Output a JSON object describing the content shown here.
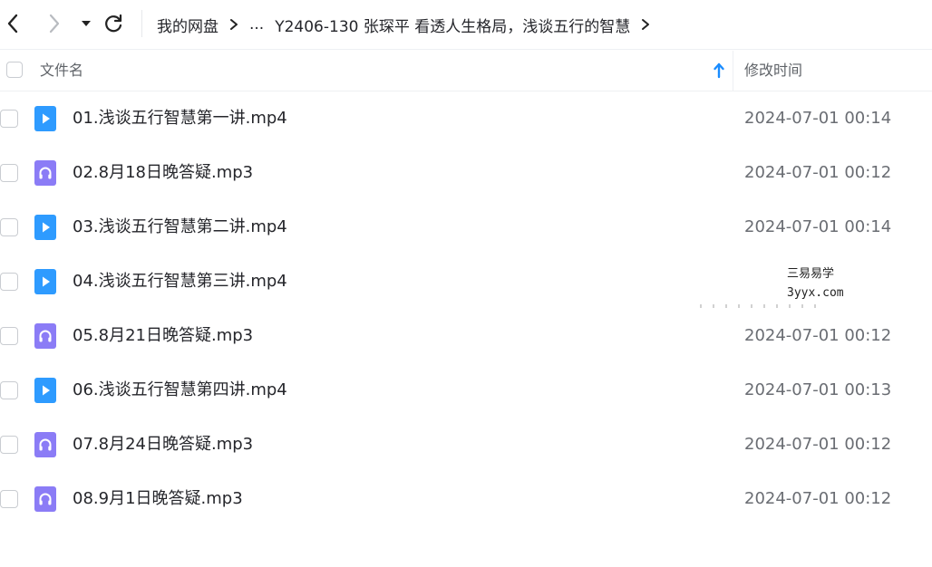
{
  "toolbar": {
    "icons": {
      "back": "chevron-left-icon",
      "forward": "chevron-right-icon",
      "history": "triangle-down-icon",
      "refresh": "refresh-icon"
    },
    "breadcrumb": {
      "root": "我的网盘",
      "ellipsis": "...",
      "current": "Y2406-130 张琛平 看透人生格局，浅谈五行的智慧"
    }
  },
  "list_header": {
    "name_label": "文件名",
    "time_label": "修改时间",
    "sort_icon": "arrow-up-icon",
    "accent_color": "#1a8cff"
  },
  "files": [
    {
      "name": "01.浅谈五行智慧第一讲.mp4",
      "time": "2024-07-01 00:14",
      "type": "video"
    },
    {
      "name": "02.8月18日晚答疑.mp3",
      "time": "2024-07-01 00:12",
      "type": "audio"
    },
    {
      "name": "03.浅谈五行智慧第二讲.mp4",
      "time": "2024-07-01 00:14",
      "type": "video"
    },
    {
      "name": "04.浅谈五行智慧第三讲.mp4",
      "time": "",
      "type": "video"
    },
    {
      "name": "05.8月21日晚答疑.mp3",
      "time": "2024-07-01 00:12",
      "type": "audio"
    },
    {
      "name": "06.浅谈五行智慧第四讲.mp4",
      "time": "2024-07-01 00:13",
      "type": "video"
    },
    {
      "name": "07.8月24日晚答疑.mp3",
      "time": "2024-07-01 00:12",
      "type": "audio"
    },
    {
      "name": "08.9月1日晚答疑.mp3",
      "time": "2024-07-01 00:12",
      "type": "audio"
    }
  ],
  "colors": {
    "video_icon": "#2e9bff",
    "audio_icon": "#8b7cf6"
  },
  "watermark": {
    "line1": "三易易学",
    "line2": "3yyx.com"
  }
}
